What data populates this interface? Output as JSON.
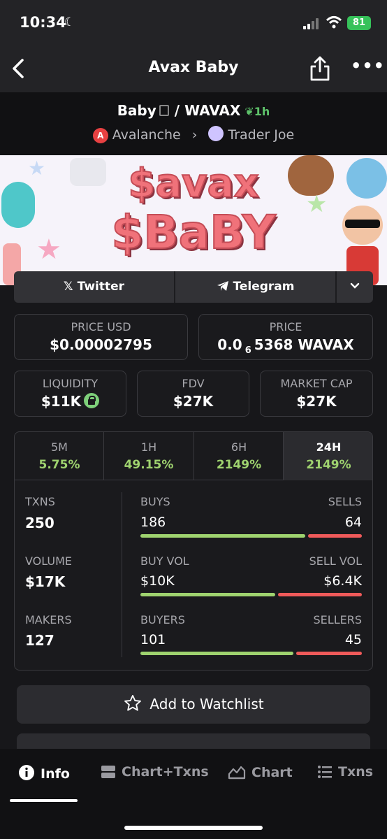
{
  "status": {
    "time": "10:34",
    "battery": "81"
  },
  "header": {
    "title": "Avax Baby"
  },
  "pair": {
    "base": "Baby",
    "quote": "WAVAX",
    "age": "1h",
    "chain": "Avalanche",
    "dex": "Trader Joe"
  },
  "banner": {
    "line1": "$avax",
    "line2": "$BaBY"
  },
  "social": {
    "twitter": "Twitter",
    "telegram": "Telegram"
  },
  "stats": {
    "price_usd_label": "PRICE USD",
    "price_usd": "$0.00002795",
    "price_label": "PRICE",
    "price_pre": "0.0",
    "price_sub": "6",
    "price_post": "5368 WAVAX",
    "liquidity_label": "LIQUIDITY",
    "liquidity": "$11K",
    "fdv_label": "FDV",
    "fdv": "$27K",
    "mcap_label": "MARKET CAP",
    "mcap": "$27K"
  },
  "timeframes": [
    {
      "label": "5M",
      "value": "5.75%"
    },
    {
      "label": "1H",
      "value": "49.15%"
    },
    {
      "label": "6H",
      "value": "2149%"
    },
    {
      "label": "24H",
      "value": "2149%"
    }
  ],
  "metrics": {
    "txns_label": "TXNS",
    "txns": "250",
    "buys_label": "BUYS",
    "buys": "186",
    "sells_label": "SELLS",
    "sells": "64",
    "buys_fraction": 0.744,
    "volume_label": "VOLUME",
    "volume": "$17K",
    "buyvol_label": "BUY VOL",
    "buyvol": "$10K",
    "sellvol_label": "SELL VOL",
    "sellvol": "$6.4K",
    "buyvol_fraction": 0.61,
    "makers_label": "MAKERS",
    "makers": "127",
    "buyers_label": "BUYERS",
    "buyers": "101",
    "sellers_label": "SELLERS",
    "sellers": "45",
    "buyers_fraction": 0.692
  },
  "watchlist": {
    "label": "Add to Watchlist"
  },
  "tabs": {
    "info": "Info",
    "chart_txns": "Chart+Txns",
    "chart": "Chart",
    "txns": "Txns"
  },
  "colors": {
    "green": "#9fd36f",
    "red": "#ef5a5a",
    "battery": "#36c25a"
  }
}
